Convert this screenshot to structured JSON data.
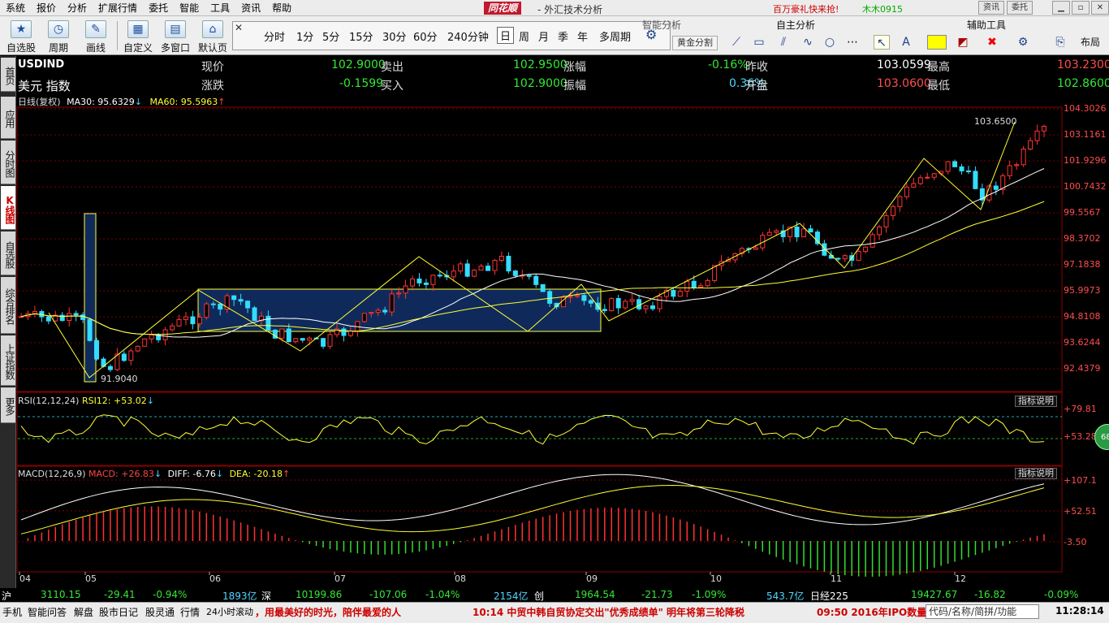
{
  "menubar": {
    "items": [
      "系统",
      "报价",
      "分析",
      "扩展行情",
      "委托",
      "智能",
      "工具",
      "资讯",
      "帮助"
    ],
    "brand": "同花顺",
    "app_title": "- 外汇技术分析",
    "promo": "百万豪礼快来抢!",
    "user": "木木0915",
    "mini_buttons": [
      "资讯",
      "委托"
    ]
  },
  "toolbar": {
    "buttons": [
      "自选股",
      "周期",
      "画线",
      "自定义",
      "多窗口",
      "默认页"
    ],
    "periods": [
      "分时",
      "1分",
      "5分",
      "15分",
      "30分",
      "60分",
      "240分钟",
      "日",
      "周",
      "月",
      "季",
      "年",
      "多周期"
    ],
    "active_period": "日",
    "panel_smart": "智能分析",
    "panel_self": "自主分析",
    "panel_aux": "辅助工具",
    "gold_button": "黄金分割",
    "layout_button": "布局"
  },
  "sidebar": {
    "tabs": [
      "首页",
      "应用",
      "分时图",
      "K线图",
      "自选股",
      "综合排名",
      "上证指数",
      "更多"
    ],
    "active": "K线图"
  },
  "quote": {
    "symbol": "USDIND",
    "name": "美元 指数",
    "row1": [
      {
        "label": "现价",
        "value": "102.9000"
      },
      {
        "label": "卖出",
        "value": "102.9500"
      },
      {
        "label": "涨幅",
        "value": "-0.16%"
      },
      {
        "label": "昨收",
        "value": "103.0599"
      },
      {
        "label": "最高",
        "value": "103.2300"
      }
    ],
    "row2": [
      {
        "label": "涨跌",
        "value": "-0.1599"
      },
      {
        "label": "买入",
        "value": "102.9000"
      },
      {
        "label": "振幅",
        "value": "0.36%"
      },
      {
        "label": "开盘",
        "value": "103.0600"
      },
      {
        "label": "最低",
        "value": "102.8600"
      }
    ]
  },
  "kline": {
    "header": "日线(复权)",
    "ma30": "MA30: 95.6329",
    "ma60": "MA60: 95.5963",
    "high_marker": "103.6500",
    "low_marker": "91.9040",
    "price_scale": [
      "104.3026",
      "103.1161",
      "101.9296",
      "100.7432",
      "99.5567",
      "98.3702",
      "97.1838",
      "95.9973",
      "94.8108",
      "93.6244",
      "92.4379"
    ],
    "xaxis": [
      "04",
      "05",
      "06",
      "07",
      "08",
      "09",
      "10",
      "11",
      "12"
    ]
  },
  "rsi": {
    "label": "RSI(12,12,24)",
    "value": "RSI12: +53.02",
    "scale": [
      "+79.81",
      "+53.28"
    ],
    "hint": "指标说明",
    "badge": "68"
  },
  "macd": {
    "label": "MACD(12,26,9)",
    "macd": "MACD: +26.83",
    "diff": "DIFF: -6.76",
    "dea": "DEA: -20.18",
    "scale": [
      "+107.1",
      "+52.51",
      "-3.50"
    ],
    "hint": "指标说明"
  },
  "status": {
    "sh_label": "沪",
    "sh_value": "3110.15",
    "sh_change": "-29.41",
    "sh_pct": "-0.94%",
    "sh_amount": "1893亿",
    "sz_label": "深",
    "sz_value": "10199.86",
    "sz_change": "-107.06",
    "sz_pct": "-1.04%",
    "sz_amount": "2154亿",
    "cy_label": "创",
    "cy_value": "1964.54",
    "cy_change": "-21.73",
    "cy_pct": "-1.09%",
    "cy_amount": "543.7亿",
    "nk_label": "日经225",
    "nk_value": "19427.67",
    "nk_change": "-16.82",
    "nk_pct": "-0.09%"
  },
  "bottom": {
    "items": [
      "手机",
      "智能问答",
      "解盘",
      "股市日记",
      "股灵通",
      "行情",
      "24小时滚动"
    ],
    "news1": "，用最美好的时光，陪伴最爱的人",
    "news2": "10:14 中贸中韩自贸协定交出\"优秀成绩单\" 明年将第三轮降税",
    "news3": "09:50 2016年IPO数量",
    "search_placeholder": "代码/名称/简拼/功能",
    "time": "11:28:14"
  },
  "colors": {
    "up": "#ff3333",
    "down": "#33ddff",
    "ma30": "#ffffff",
    "ma60": "#ffff33",
    "grid": "#7a0000"
  }
}
